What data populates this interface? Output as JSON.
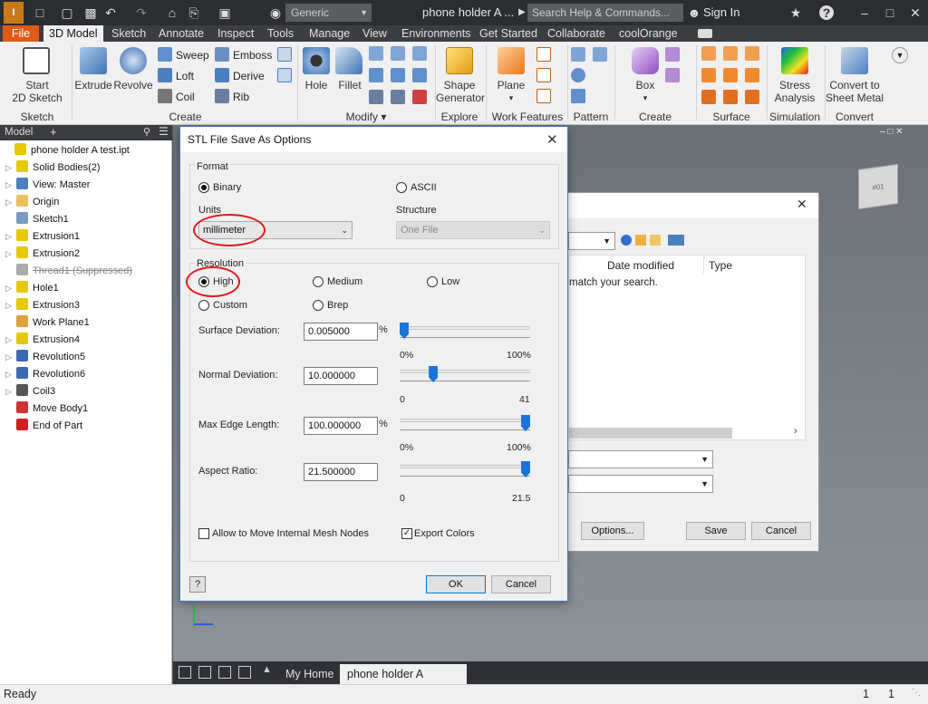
{
  "titlebar": {
    "app_style": "Generic",
    "document_title": "phone holder A ...",
    "search_placeholder": "Search Help & Commands...",
    "sign_in": "Sign In"
  },
  "ribbon_tabs": [
    "File",
    "3D Model",
    "Sketch",
    "Annotate",
    "Inspect",
    "Tools",
    "Manage",
    "View",
    "Environments",
    "Get Started",
    "Collaborate",
    "coolOrange"
  ],
  "ribbon": {
    "sketch": {
      "start_line1": "Start",
      "start_line2": "2D Sketch",
      "title": "Sketch"
    },
    "create": {
      "extrude": "Extrude",
      "revolve": "Revolve",
      "sweep": "Sweep",
      "loft": "Loft",
      "coil": "Coil",
      "emboss": "Emboss",
      "derive": "Derive",
      "rib": "Rib",
      "title": "Create"
    },
    "modify": {
      "hole": "Hole",
      "fillet": "Fillet",
      "title": "Modify"
    },
    "explore": {
      "shape_line1": "Shape",
      "shape_line2": "Generator",
      "title": "Explore"
    },
    "work_features": {
      "plane": "Plane",
      "title": "Work Features"
    },
    "pattern": {
      "title": "Pattern"
    },
    "create_freeform": {
      "box": "Box",
      "title": "Create Freeform"
    },
    "surface": {
      "title": "Surface"
    },
    "simulation": {
      "stress_line1": "Stress",
      "stress_line2": "Analysis",
      "title": "Simulation"
    },
    "convert": {
      "line1": "Convert to",
      "line2": "Sheet Metal",
      "title": "Convert"
    }
  },
  "browser": {
    "header": "Model",
    "items": [
      {
        "label": "phone holder A test.ipt",
        "color": "#e6c800"
      },
      {
        "label": "Solid Bodies(2)",
        "color": "#e6c800"
      },
      {
        "label": "View: Master",
        "color": "#4a7fc0"
      },
      {
        "label": "Origin",
        "color": "#e8c060"
      },
      {
        "label": "Sketch1",
        "color": "#7a9ac0"
      },
      {
        "label": "Extrusion1",
        "color": "#e6c800"
      },
      {
        "label": "Extrusion2",
        "color": "#e6c800"
      },
      {
        "label": "Thread1 (Suppressed)",
        "color": "#aaaaaa"
      },
      {
        "label": "Hole1",
        "color": "#e6c800"
      },
      {
        "label": "Extrusion3",
        "color": "#e6c800"
      },
      {
        "label": "Work Plane1",
        "color": "#e0a040"
      },
      {
        "label": "Extrusion4",
        "color": "#e6c800"
      },
      {
        "label": "Revolution5",
        "color": "#3a6ab0"
      },
      {
        "label": "Revolution6",
        "color": "#3a6ab0"
      },
      {
        "label": "Coil3",
        "color": "#555555"
      },
      {
        "label": "Move Body1",
        "color": "#d23030"
      },
      {
        "label": "End of Part",
        "color": "#d21e1e"
      }
    ]
  },
  "save_as": {
    "col_date": "Date modified",
    "col_type": "Type",
    "empty_msg": "match your search.",
    "options_btn": "Options...",
    "save_btn": "Save",
    "cancel_btn": "Cancel"
  },
  "stl": {
    "title": "STL File Save As Options",
    "format": {
      "label": "Format",
      "binary": "Binary",
      "ascii": "ASCII"
    },
    "units": {
      "label": "Units",
      "value": "millimeter"
    },
    "structure": {
      "label": "Structure",
      "value": "One File"
    },
    "resolution": {
      "label": "Resolution",
      "high": "High",
      "medium": "Medium",
      "low": "Low",
      "custom": "Custom",
      "brep": "Brep"
    },
    "surface_deviation": {
      "label": "Surface Deviation:",
      "value": "0.005000",
      "unit": "%",
      "min": "0%",
      "max": "100%",
      "level": 0
    },
    "normal_deviation": {
      "label": "Normal Deviation:",
      "value": "10.000000",
      "min": "0",
      "max": "41",
      "level": 0.24
    },
    "max_edge_length": {
      "label": "Max Edge Length:",
      "value": "100.000000",
      "unit": "%",
      "min": "0%",
      "max": "100%",
      "level": 1
    },
    "aspect_ratio": {
      "label": "Aspect Ratio:",
      "value": "21.500000",
      "min": "0",
      "max": "21.5",
      "level": 1
    },
    "allow_move": "Allow to Move Internal Mesh Nodes",
    "export_colors": "Export Colors",
    "ok": "OK",
    "cancel": "Cancel"
  },
  "doc_tabs": {
    "home": "My Home",
    "active": "phone holder A t...ipt"
  },
  "status": {
    "text": "Ready",
    "n1": "1",
    "n2": "1"
  }
}
